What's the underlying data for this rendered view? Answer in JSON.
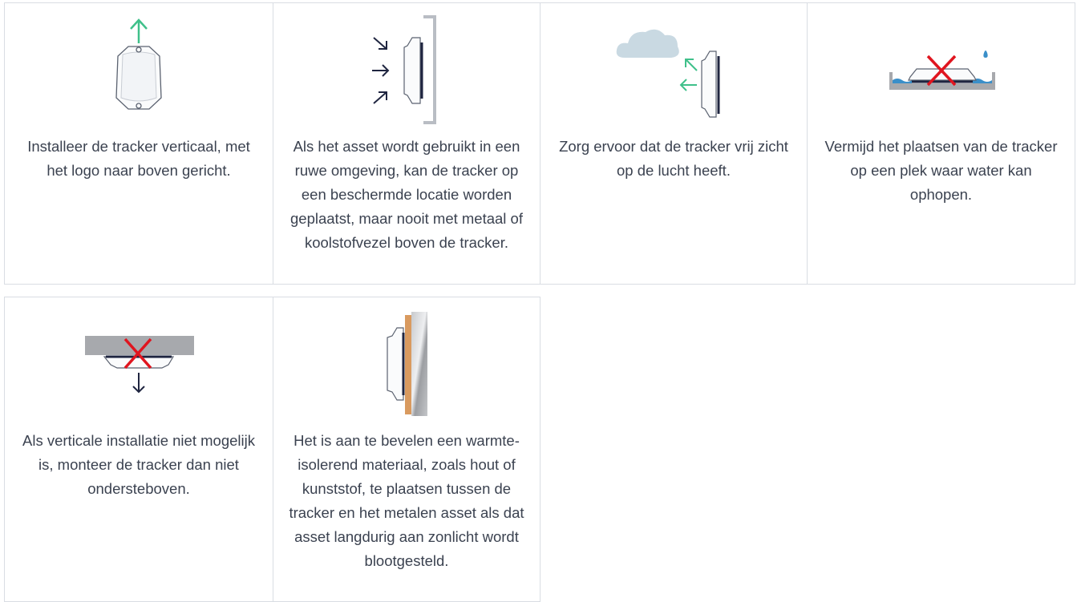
{
  "tips": [
    {
      "text": "Installeer de tracker verticaal, met het logo naar boven gericht.",
      "icon": "tracker-vertical-up-icon"
    },
    {
      "text": "Als het asset wordt gebruikt in een ruwe omgeving, kan de tracker op een beschermde locatie worden geplaatst, maar nooit met metaal of koolstofvezel boven de tracker.",
      "icon": "tracker-protected-location-icon"
    },
    {
      "text": "Zorg ervoor dat de tracker vrij zicht op de lucht heeft.",
      "icon": "tracker-sky-view-icon"
    },
    {
      "text": "Vermijd het plaatsen van de tracker op een plek waar water kan ophopen.",
      "icon": "tracker-no-water-icon"
    },
    {
      "text": "Als verticale installatie niet mogelijk is, monteer de tracker dan niet ondersteboven.",
      "icon": "tracker-not-upside-down-icon"
    },
    {
      "text": "Het is aan te bevelen een warmte-isolerend materiaal, zoals hout of kunststof, te plaatsen tussen de tracker en het metalen asset als dat asset langdurig aan zonlicht wordt blootgesteld.",
      "icon": "tracker-heat-insulation-icon"
    }
  ],
  "colors": {
    "border": "#d9dde3",
    "text": "#3b4250",
    "arrow_green": "#3fc08a",
    "navy": "#1f2540",
    "cross_red": "#e0151f",
    "cloud": "#c9d9e2",
    "water": "#3a8fc9",
    "wood": "#d99a5f",
    "metal": "#a7a9ad"
  }
}
